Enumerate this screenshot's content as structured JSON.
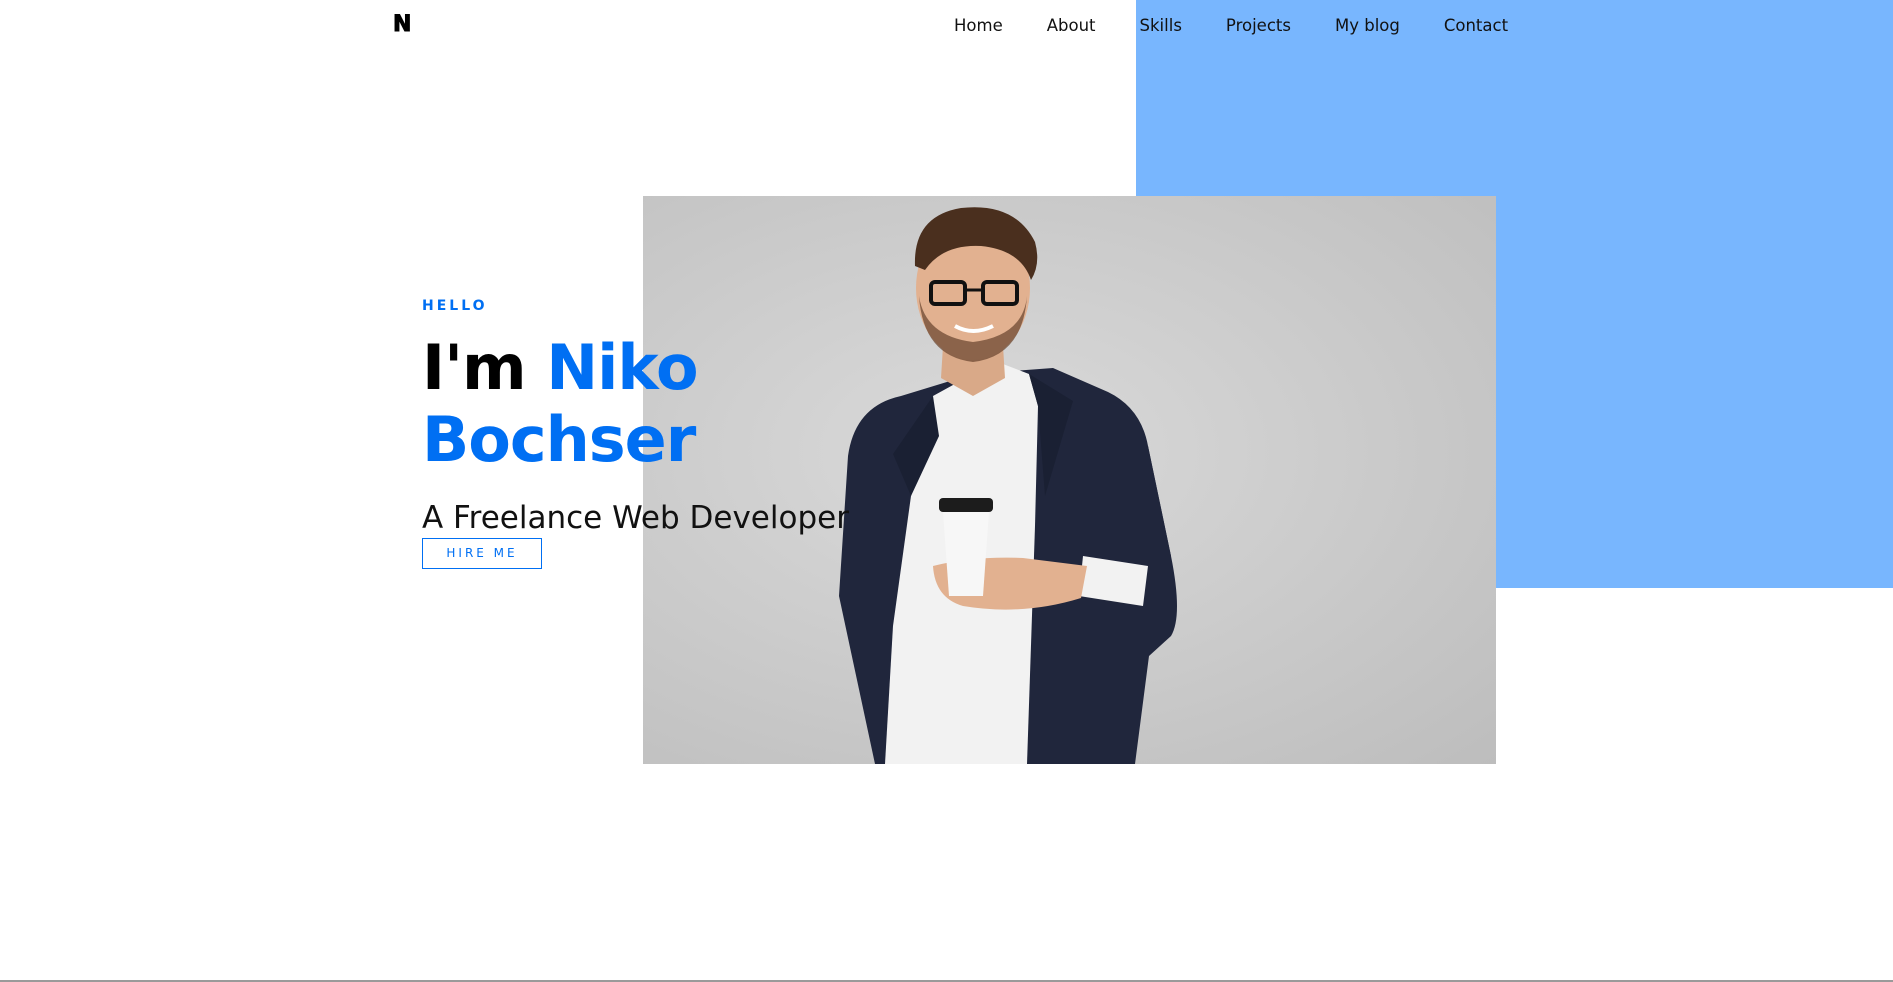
{
  "nav": {
    "logo": "N",
    "links": [
      "Home",
      "About",
      "Skills",
      "Projects",
      "My blog",
      "Contact"
    ]
  },
  "hero": {
    "greeting": "HELLO",
    "intro": "I'm",
    "first_name": "Niko",
    "last_name": "Bochser",
    "role": "A Freelance Web Developer",
    "cta_label": "HIRE ME"
  },
  "colors": {
    "accent": "#006ff3",
    "accent_block": "#78b6fe",
    "photo_bg": "#c8c8c8"
  }
}
